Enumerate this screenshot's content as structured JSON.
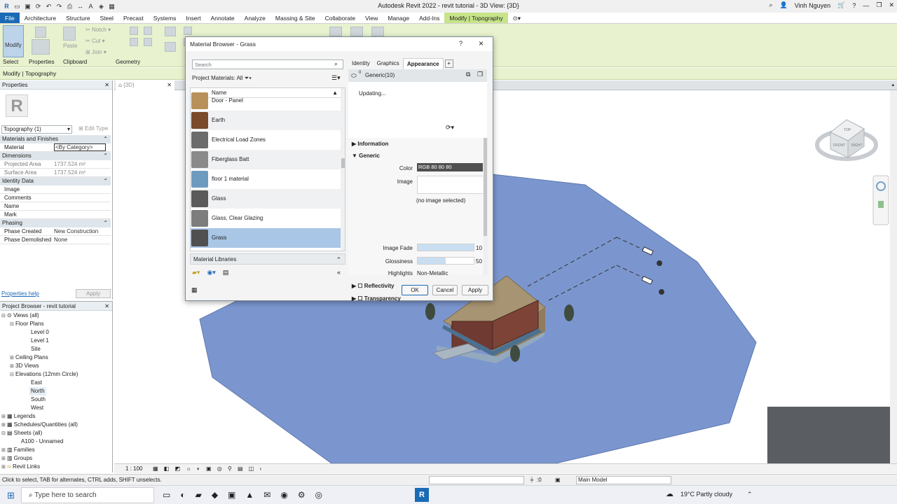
{
  "titlebar": {
    "title": "Autodesk Revit 2022 - revit tutorial - 3D View: {3D}",
    "user": "Vinh Nguyen"
  },
  "ribbon": {
    "tabs": [
      "File",
      "Architecture",
      "Structure",
      "Steel",
      "Precast",
      "Systems",
      "Insert",
      "Annotate",
      "Analyze",
      "Massing & Site",
      "Collaborate",
      "View",
      "Manage",
      "Add-Ins",
      "Modify | Topography"
    ],
    "modify_label": "Modify",
    "paste_label": "Paste",
    "notch_label": "Notch",
    "cut_label": "Cut",
    "join_label": "Join",
    "panel_labels": [
      "Select",
      "Properties",
      "Clipboard",
      "Geometry"
    ],
    "context_label": "Modify | Topography"
  },
  "properties": {
    "header": "Properties",
    "type_selector": "Topography (1)",
    "edit_type": "Edit Type",
    "groups": {
      "materials": "Materials and Finishes",
      "dimensions": "Dimensions",
      "identity": "Identity Data",
      "phasing": "Phasing"
    },
    "rows": {
      "material_k": "Material",
      "material_v": "<By Category>",
      "proj_area_k": "Projected Area",
      "proj_area_v": "1737.524 m²",
      "surf_area_k": "Surface Area",
      "surf_area_v": "1737.524 m²",
      "image_k": "Image",
      "comments_k": "Comments",
      "name_k": "Name",
      "mark_k": "Mark",
      "phase_created_k": "Phase Created",
      "phase_created_v": "New Construction",
      "phase_demolished_k": "Phase Demolished",
      "phase_demolished_v": "None"
    },
    "help_link": "Properties help",
    "apply": "Apply"
  },
  "browser": {
    "header": "Project Browser - revit tutorial",
    "nodes": {
      "views": "Views (all)",
      "floor_plans": "Floor Plans",
      "level0": "Level 0",
      "level1": "Level 1",
      "site": "Site",
      "ceiling_plans": "Ceiling Plans",
      "views3d": "3D Views",
      "elevations": "Elevations (12mm Circle)",
      "east": "East",
      "north": "North",
      "south": "South",
      "west": "West",
      "legends": "Legends",
      "schedules": "Schedules/Quantities (all)",
      "sheets": "Sheets (all)",
      "a100": "A100 - Unnamed",
      "families": "Families",
      "groups": "Groups",
      "revit_links": "Revit Links"
    }
  },
  "view": {
    "tab_label": "{3D}",
    "scale": "1 : 100",
    "viewcube_top": "TOP",
    "viewcube_front": "FRONT",
    "viewcube_right": "RIGHT"
  },
  "status": {
    "message": "Click to select, TAB for alternates, CTRL adds, SHIFT unselects.",
    "sel_count": ":0",
    "model": "Main Model"
  },
  "taskbar": {
    "search": "Type here to search",
    "weather": "19°C  Partly cloudy"
  },
  "dialog": {
    "title": "Material Browser - Grass",
    "help": "?",
    "search_placeholder": "Search",
    "project_materials": "Project Materials: All",
    "column_name": "Name",
    "materials": [
      {
        "name": "Door - Panel",
        "color": "#b8915a"
      },
      {
        "name": "Earth",
        "color": "#7a4a2a"
      },
      {
        "name": "Electrical Load Zones",
        "color": "#6b6b6b"
      },
      {
        "name": "Fiberglass Batt",
        "color": "#8a8a8a"
      },
      {
        "name": "floor 1 material",
        "color": "#6d9bc0"
      },
      {
        "name": "Glass",
        "color": "#5a5a5a"
      },
      {
        "name": "Glass, Clear Glazing",
        "color": "#7d7d7d"
      },
      {
        "name": "Grass",
        "color": "#505050"
      }
    ],
    "libraries": "Material Libraries",
    "tabs": [
      "Identity",
      "Graphics",
      "Appearance"
    ],
    "asset_name": "Generic(10)",
    "asset_count": "0",
    "updating": "Updating...",
    "sections": {
      "information": "Information",
      "generic": "Generic",
      "reflectivity": "Reflectivity",
      "transparency": "Transparency"
    },
    "labels": {
      "color": "Color",
      "image": "Image",
      "image_fade": "Image Fade",
      "glossiness": "Glossiness",
      "highlights": "Highlights"
    },
    "values": {
      "color": "RGB 80 80 80",
      "no_image": "(no image selected)",
      "image_fade": "10",
      "glossiness": "50",
      "highlights": "Non-Metallic"
    },
    "image_fade_fraction": 1.0,
    "glossiness_fraction": 0.5,
    "buttons": {
      "ok": "OK",
      "cancel": "Cancel",
      "apply": "Apply"
    }
  },
  "colors": {
    "accent": "#1b6ab5",
    "ribbon": "#e8f2cf",
    "toposurface": "#7b96cf",
    "selected_row": "#a9c6e6"
  }
}
